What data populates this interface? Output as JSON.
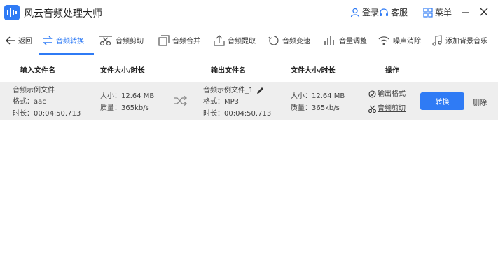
{
  "app": {
    "title": "风云音频处理大师",
    "login": "登录",
    "service": "客服",
    "menu": "菜单"
  },
  "toolbar": {
    "back": "返回",
    "items": [
      {
        "label": "音频转换",
        "icon": "convert-icon"
      },
      {
        "label": "音频剪切",
        "icon": "cut-icon"
      },
      {
        "label": "音频合并",
        "icon": "merge-icon"
      },
      {
        "label": "音频提取",
        "icon": "extract-icon"
      },
      {
        "label": "音频变速",
        "icon": "speed-icon"
      },
      {
        "label": "音量调整",
        "icon": "volume-icon"
      },
      {
        "label": "噪声消除",
        "icon": "noise-icon"
      },
      {
        "label": "添加背景音乐",
        "icon": "music-icon"
      }
    ]
  },
  "table": {
    "headers": {
      "input_file": "输入文件名",
      "input_size": "文件大小/时长",
      "output_file": "输出文件名",
      "output_size": "文件大小/时长",
      "actions": "操作"
    },
    "rows": [
      {
        "input_name": "音频示例文件",
        "input_format": "格式：aac",
        "input_duration": "时长：00:04:50.713",
        "input_size": "大小：12.64 MB",
        "input_quality": "质量：365kb/s",
        "output_name": "音频示例文件_1",
        "output_format": "格式：MP3",
        "output_duration": "时长：00:04:50.713",
        "output_size": "大小：12.64 MB",
        "output_quality": "质量：365kb/s",
        "output_format_link": "输出格式",
        "cut_link": "音频剪切",
        "convert_button": "转换",
        "delete_link": "删除"
      }
    ]
  },
  "colors": {
    "accent": "#2f7bf5",
    "row_bg": "#eeeeee"
  }
}
